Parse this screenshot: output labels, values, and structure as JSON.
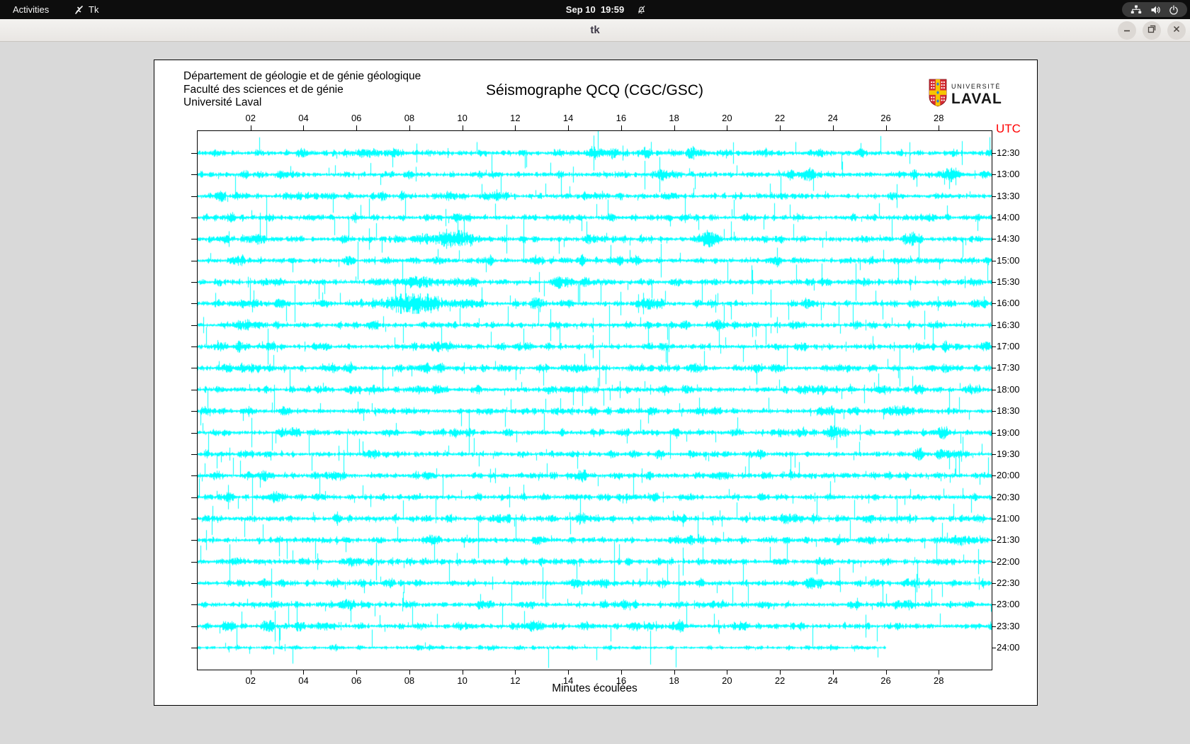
{
  "topbar": {
    "activities_label": "Activities",
    "app_name": "Tk",
    "clock": "Sep 10  19:59",
    "status_icons": [
      "network-icon",
      "volume-icon",
      "power-icon"
    ]
  },
  "titlebar": {
    "title": "tk",
    "control_icons": [
      "minimize-icon",
      "restore-icon",
      "close-icon"
    ]
  },
  "canvas_header": {
    "department_lines": [
      "Département de géologie et de génie géologique",
      "Faculté des sciences et de génie",
      "Université Laval"
    ],
    "logo": {
      "line1": "UNIVERSITÉ",
      "line2": "LAVAL"
    }
  },
  "chart_data": {
    "type": "line",
    "title": "Séismographe QCQ (CGC/GSC)",
    "xlabel": "Minutes écoulées",
    "right_axis_title": "UTC",
    "x_range_minutes": [
      0,
      30
    ],
    "x_tick_labels": [
      "02",
      "04",
      "06",
      "08",
      "10",
      "12",
      "14",
      "16",
      "18",
      "20",
      "22",
      "24",
      "26",
      "28"
    ],
    "row_labels": [
      "12:30",
      "13:00",
      "13:30",
      "14:00",
      "14:30",
      "15:00",
      "15:30",
      "16:00",
      "16:30",
      "17:00",
      "17:30",
      "18:00",
      "18:30",
      "19:00",
      "19:30",
      "20:00",
      "20:30",
      "21:00",
      "21:30",
      "22:00",
      "22:30",
      "23:00",
      "23:30",
      "24:00"
    ],
    "rows": 24,
    "trace_color": "#00ffff",
    "axis_color": "#000000",
    "utc_color": "#ff0000",
    "last_row_end_minute": 26,
    "seed": 911,
    "events": [
      {
        "row_label": "14:30",
        "row": 4,
        "center_min": 9.7,
        "width_min": 0.55,
        "amplitude": 7.5
      },
      {
        "row_label": "15:30",
        "row": 6,
        "center_min": 8.6,
        "width_min": 0.7,
        "amplitude": 2.6
      },
      {
        "row_label": "16:00",
        "row": 7,
        "center_min": 8.1,
        "width_min": 0.85,
        "amplitude": 9.0
      }
    ]
  },
  "colors": {
    "topbar_bg": "#0d0d0d",
    "titlebar_bg": "#ebe8e5",
    "content_bg": "#d9d9d9",
    "logo_red": "#d42a33",
    "logo_gold": "#f7c600",
    "logo_blue": "#2f7fd6"
  }
}
